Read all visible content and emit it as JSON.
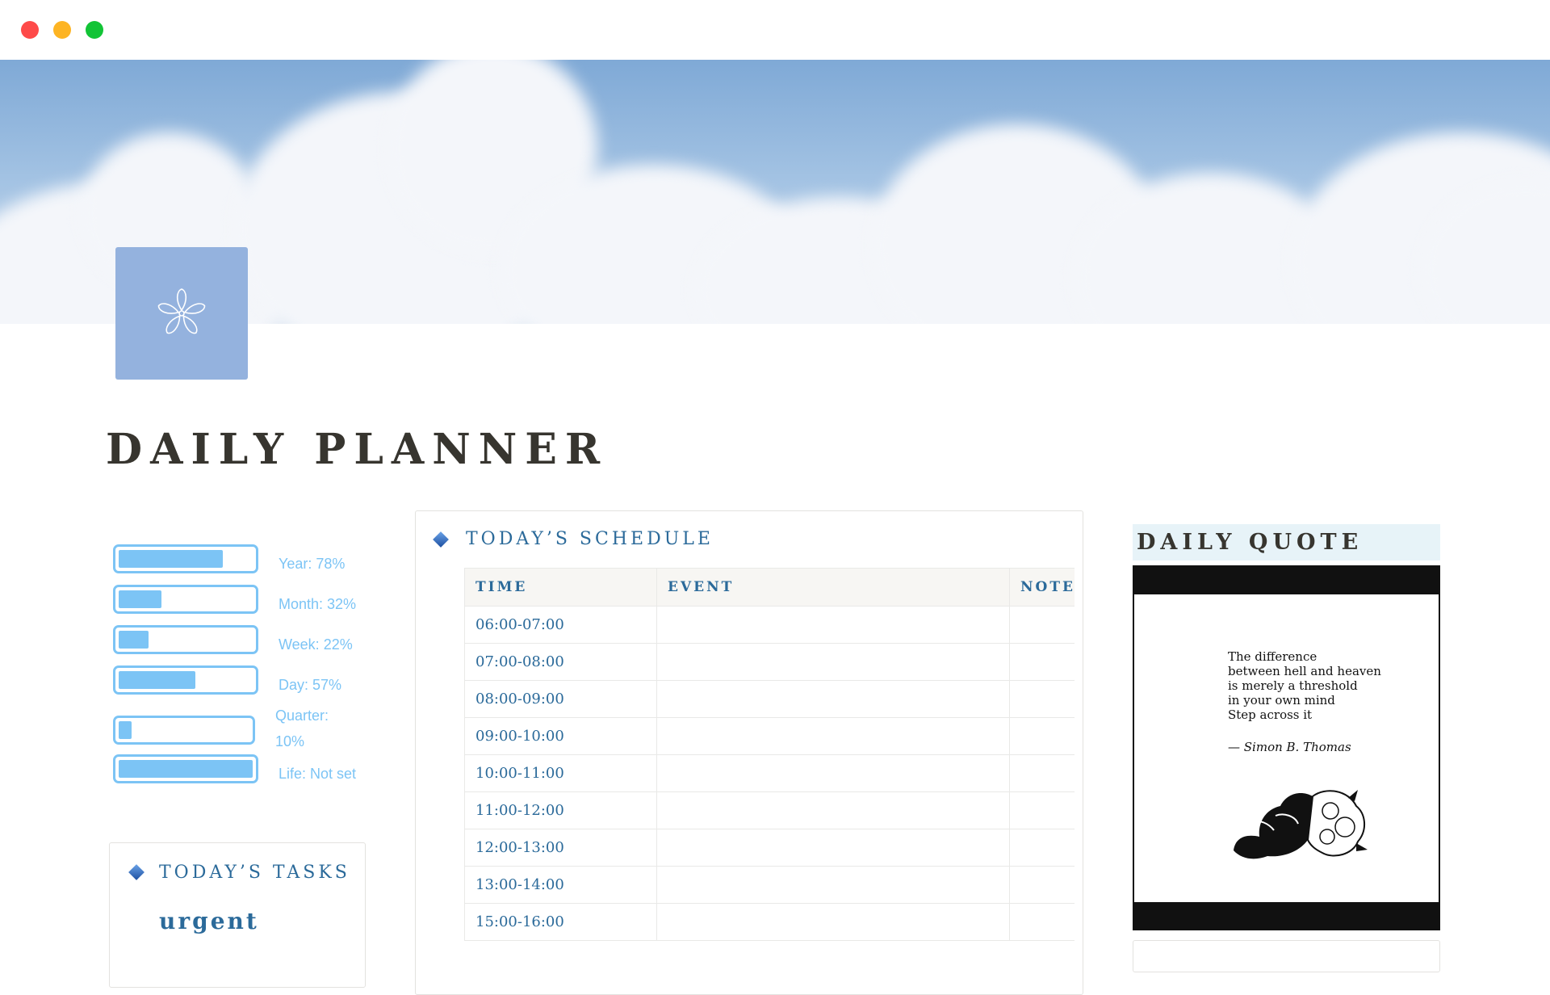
{
  "page": {
    "title": "DAILY PLANNER",
    "icon": "flower-icon",
    "cover": "sky-clouds-cover"
  },
  "colors": {
    "accent": "#2b6a9a",
    "progress": "#7cc4f5",
    "icon_bg": "#94b2de",
    "quote_heading_bg": "#e7f3f8"
  },
  "progress": [
    {
      "label": "Year: 78%",
      "value": 0.78
    },
    {
      "label": "Month: 32%",
      "value": 0.32
    },
    {
      "label": "Week: 22%",
      "value": 0.22
    },
    {
      "label": "Day: 57%",
      "value": 0.57
    },
    {
      "label": "Quarter: 10%",
      "value": 0.1
    },
    {
      "label": "Life: Not set",
      "value": 1.0
    }
  ],
  "tasks": {
    "heading": "TODAY’S TASKS",
    "group_label": "urgent"
  },
  "schedule": {
    "heading": "TODAY’S SCHEDULE",
    "columns": [
      "TIME",
      "EVENT",
      "NOTES"
    ],
    "rows": [
      {
        "time": "06:00-07:00",
        "event": "",
        "notes": ""
      },
      {
        "time": "07:00-08:00",
        "event": "",
        "notes": ""
      },
      {
        "time": "08:00-09:00",
        "event": "",
        "notes": ""
      },
      {
        "time": "09:00-10:00",
        "event": "",
        "notes": ""
      },
      {
        "time": "10:00-11:00",
        "event": "",
        "notes": ""
      },
      {
        "time": "11:00-12:00",
        "event": "",
        "notes": ""
      },
      {
        "time": "12:00-13:00",
        "event": "",
        "notes": ""
      },
      {
        "time": "13:00-14:00",
        "event": "",
        "notes": ""
      },
      {
        "time": "15:00-16:00",
        "event": "",
        "notes": ""
      }
    ]
  },
  "quote": {
    "heading": "DAILY QUOTE",
    "text": "The difference\nbetween hell and heaven\nis merely a threshold\nin your own mind\nStep across it",
    "author": "— Simon B. Thomas"
  }
}
